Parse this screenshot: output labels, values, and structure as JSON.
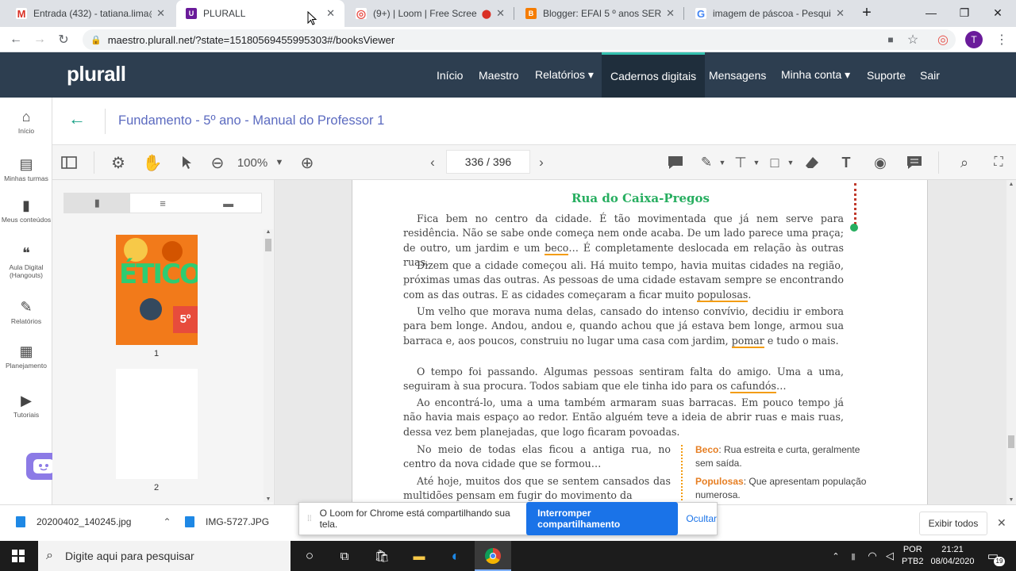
{
  "browser": {
    "tabs": [
      {
        "title": "Entrada (432) - tatiana.lima@p",
        "fav": "M",
        "color": "#d93025"
      },
      {
        "title": "PLURALL",
        "fav": "U",
        "color": "#6a1b9a"
      },
      {
        "title": "(9+) | Loom | Free Screen",
        "fav": "◎",
        "color": "#e8554e"
      },
      {
        "title": "Blogger: EFAI 5 º anos SER - To",
        "fav": "B",
        "color": "#f57c00"
      },
      {
        "title": "imagem de páscoa - Pesquisa",
        "fav": "G",
        "color": "#4285f4"
      }
    ],
    "url": "maestro.plurall.net/?state=15180569455995303#/booksViewer",
    "profile_initial": "T"
  },
  "header": {
    "logo": "plurall",
    "nav": [
      "Início",
      "Maestro",
      "Relatórios ▾",
      "Cadernos digitais",
      "Mensagens",
      "Minha conta ▾",
      "Suporte",
      "Sair"
    ]
  },
  "sidebar": [
    {
      "label": "Início",
      "icon": "home-icon",
      "glyph": "⌂"
    },
    {
      "label": "Minhas turmas",
      "icon": "class-icon",
      "glyph": "▤"
    },
    {
      "label": "Meus conteúdos",
      "icon": "book-icon",
      "glyph": "▮"
    },
    {
      "label": "Aula Digital (Hangouts)",
      "icon": "hangouts-icon",
      "glyph": "❝"
    },
    {
      "label": "Relatórios",
      "icon": "report-icon",
      "glyph": "✎"
    },
    {
      "label": "Planejamento",
      "icon": "clipboard-icon",
      "glyph": "▦"
    },
    {
      "label": "Tutoriais",
      "icon": "play-icon",
      "glyph": "▶"
    }
  ],
  "viewer": {
    "title": "Fundamento - 5º ano - Manual do Professor 1",
    "zoom": "100%",
    "page": "336 / 396",
    "thumb_labels": [
      "1",
      "2"
    ],
    "cover_text": "ÉTICO",
    "cover_badge": "5º"
  },
  "document": {
    "heading": "Rua do Caixa-Pregos",
    "p1a": "Fica bem no centro da cidade. É tão movimentada que já nem serve para residência. Não se sabe onde começa nem onde acaba. De um lado parece uma praça; de outro, um jardim e um ",
    "p1u": "beco",
    "p1b": "… É completamente deslocada em relação às outras ruas.",
    "p2a": "Dizem que a cidade começou ali. Há muito tempo, havia muitas cidades na região, próximas umas das outras. As pessoas de uma cidade estavam sempre se encontrando com as das outras. E as cidades começaram a ficar muito ",
    "p2u": "populosas",
    "p2b": ".",
    "p3a": "Um velho que morava numa delas, cansado do intenso convívio, decidiu ir embora para bem longe. Andou, andou e, quando achou que já estava bem longe, armou sua barraca e, aos poucos, construiu no lugar uma casa com jardim, ",
    "p3u": "pomar",
    "p3b": " e tudo o mais.",
    "p4a": "O tempo foi passando. Algumas pessoas sentiram falta do amigo. Uma a uma, seguiram à sua procura. Todos sabiam que ele tinha ido para os ",
    "p4u": "cafundós",
    "p4b": "…",
    "p5": "Ao encontrá-lo, uma a uma também armaram suas barracas. Em pouco tempo já não havia mais espaço ao redor. Então alguém teve a ideia de abrir ruas e mais ruas, dessa vez bem planejadas, que logo ficaram povoadas.",
    "p6": "No meio de todas elas ficou a antiga rua, no centro da nova cidade que se formou…",
    "p7": "Até hoje, muitos dos que se sentem cansados das multidões pensam em fugir do movimento da",
    "glossary": [
      {
        "term": "Beco",
        "def": ": Rua estreita e curta, geralmente sem saída."
      },
      {
        "term": "Populosas",
        "def": ": Que apresentam população numerosa."
      }
    ]
  },
  "downloads": [
    "20200402_140245.jpg",
    "IMG-5727.JPG"
  ],
  "downloads_show_all": "Exibir todos",
  "share_banner": {
    "text": "O Loom for Chrome está compartilhando sua tela.",
    "stop": "Interromper compartilhamento",
    "hide": "Ocultar"
  },
  "taskbar": {
    "search": "Digite aqui para pesquisar",
    "lang": "POR",
    "layout": "PTB2",
    "time": "21:21",
    "date": "08/04/2020",
    "notif": "19"
  }
}
